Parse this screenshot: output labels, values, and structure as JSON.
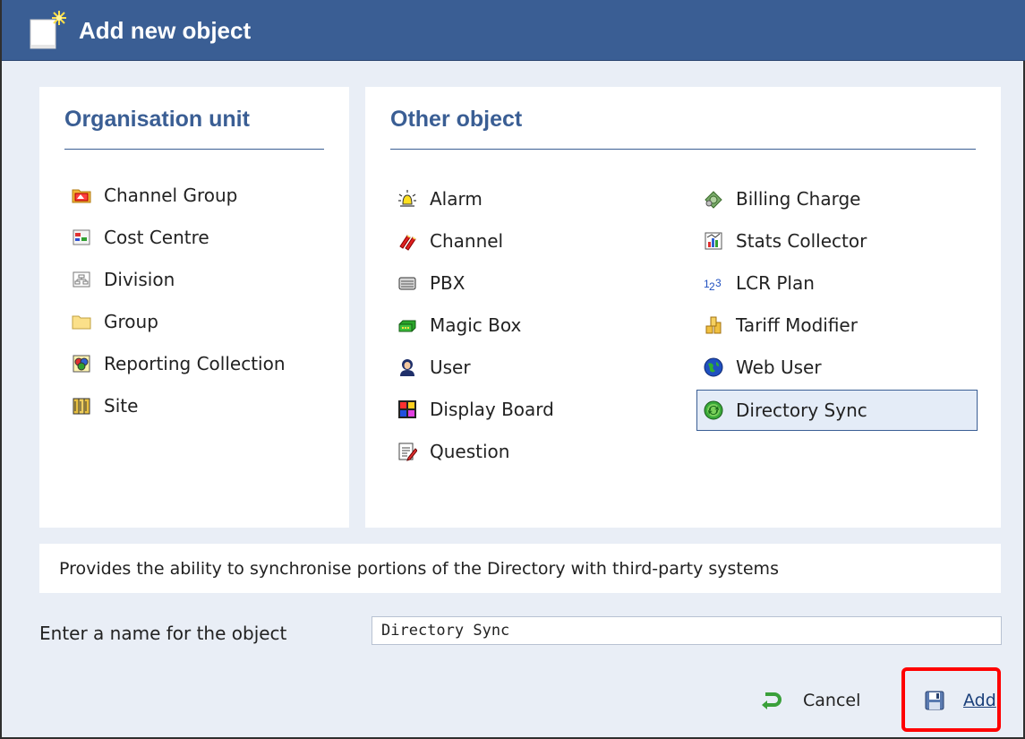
{
  "dialog": {
    "title": "Add new object",
    "title_icon": "new-object-icon"
  },
  "organisation_unit": {
    "heading": "Organisation unit",
    "items": [
      {
        "label": "Channel Group",
        "icon": "channel-group-icon"
      },
      {
        "label": "Cost Centre",
        "icon": "cost-centre-icon"
      },
      {
        "label": "Division",
        "icon": "division-icon"
      },
      {
        "label": "Group",
        "icon": "folder-icon"
      },
      {
        "label": "Reporting Collection",
        "icon": "reporting-collection-icon"
      },
      {
        "label": "Site",
        "icon": "site-icon"
      }
    ]
  },
  "other_object": {
    "heading": "Other object",
    "left_items": [
      {
        "label": "Alarm",
        "icon": "alarm-icon"
      },
      {
        "label": "Channel",
        "icon": "channel-icon"
      },
      {
        "label": "PBX",
        "icon": "pbx-icon"
      },
      {
        "label": "Magic Box",
        "icon": "magic-box-icon"
      },
      {
        "label": "User",
        "icon": "user-icon"
      },
      {
        "label": "Display Board",
        "icon": "display-board-icon"
      },
      {
        "label": "Question",
        "icon": "question-icon"
      }
    ],
    "right_items": [
      {
        "label": "Billing Charge",
        "icon": "billing-charge-icon"
      },
      {
        "label": "Stats Collector",
        "icon": "stats-collector-icon"
      },
      {
        "label": "LCR Plan",
        "icon": "lcr-plan-icon"
      },
      {
        "label": "Tariff Modifier",
        "icon": "tariff-modifier-icon"
      },
      {
        "label": "Web User",
        "icon": "web-user-icon"
      },
      {
        "label": "Directory Sync",
        "icon": "directory-sync-icon",
        "selected": true
      }
    ]
  },
  "description": "Provides the ability to synchronise portions of the Directory with third-party systems",
  "name_field": {
    "label": "Enter a name for the object",
    "value": "Directory Sync"
  },
  "buttons": {
    "cancel": "Cancel",
    "add": "Add"
  },
  "colors": {
    "titlebar": "#3a5e94",
    "heading": "#3a5e94",
    "highlight": "#ff0000"
  }
}
